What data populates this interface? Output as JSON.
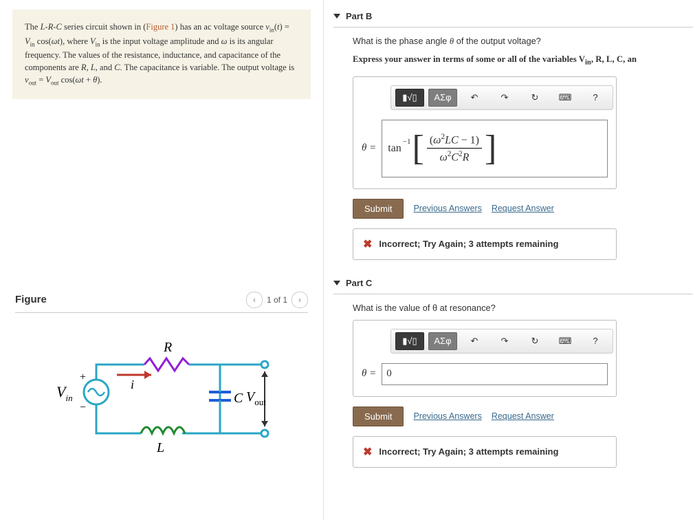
{
  "problem": {
    "text_html": "The <span class='math-i'>L</span>-<span class='math-i'>R</span>-<span class='math-i'>C</span> series circuit shown in (<span class='fig-link'>Figure 1</span>) has an ac voltage source <span class='math-i'>v</span><span class='sub'>in</span>(<span class='math-i'>t</span>) = <span class='math-i'>V</span><span class='sub'>in</span> cos(<span class='math-i'>ωt</span>), where <span class='math-i'>V</span><span class='sub'>in</span> is the input voltage amplitude and <span class='math-i'>ω</span> is its angular frequency. The values of the resistance, inductance, and capacitance of the components are <span class='math-i'>R</span>, <span class='math-i'>L</span>, and <span class='math-i'>C</span>. The capacitance is variable. The output voltage is <span class='math-i'>v</span><span class='sub'>out</span> = <span class='math-i'>V</span><span class='sub'>out</span> cos(<span class='math-i'>ωt</span> + <span class='math-i'>θ</span>)."
  },
  "figure": {
    "title": "Figure",
    "pager": "1 of 1",
    "labels": {
      "R": "R",
      "L": "L",
      "C": "C",
      "i": "i",
      "Vin": "V",
      "Vin_sub": "in",
      "Vout": "V",
      "Vout_sub": "out",
      "plus": "+",
      "minus": "−"
    }
  },
  "toolbar": {
    "templates": "▮√▯",
    "greek": "ΑΣφ",
    "undo": "↶",
    "redo": "↷",
    "reset": "↻",
    "keyboard": "⌨",
    "help": "?"
  },
  "buttons": {
    "submit": "Submit",
    "prev_answers": "Previous Answers",
    "request_answer": "Request Answer"
  },
  "parts": {
    "B": {
      "title": "Part B",
      "question": "What is the phase angle θ of the output voltage?",
      "instruct_html": "<b>Express your answer in terms of some or all of the variables <span class='math-i'>V</span><sub>in</sub>, <span class='math-i'>R</span>, <span class='math-i'>L</span>, <span class='math-i'>C</span>, an</b>",
      "lhs": "θ =",
      "answer": {
        "prefix": "tan",
        "exp": "−1",
        "numerator": "(ω²LC − 1)",
        "denominator": "ω²C²R"
      },
      "feedback": "Incorrect; Try Again; 3 attempts remaining"
    },
    "C": {
      "title": "Part C",
      "question": "What is the value of θ at resonance?",
      "lhs": "θ =",
      "answer_text": "0",
      "feedback": "Incorrect; Try Again; 3 attempts remaining"
    }
  }
}
